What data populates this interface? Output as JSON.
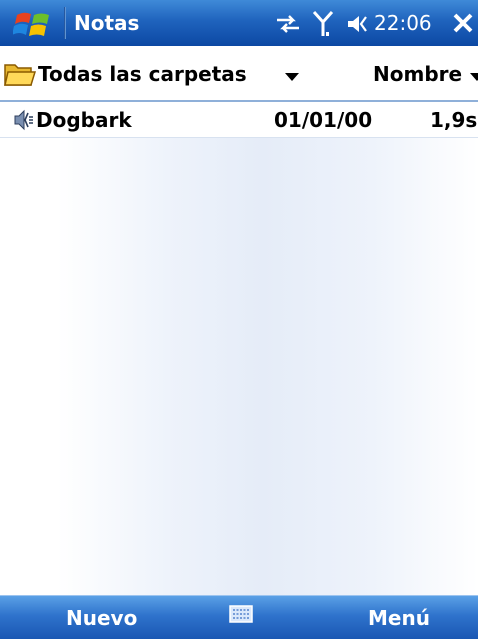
{
  "title_bar": {
    "app_title": "Notas",
    "clock": "22:06",
    "start_icon": "windows-flag-icon",
    "sync_icon": "connectivity-icon",
    "signal_icon": "signal-antenna-icon",
    "volume_icon": "speaker-icon",
    "close_icon": "close-icon"
  },
  "folder_bar": {
    "folder_label": "Todas las carpetas",
    "sort_label": "Nombre",
    "folder_icon": "folder-icon",
    "arrow_icon": "dropdown-arrow-icon"
  },
  "file_list": {
    "items": [
      {
        "icon": "sound-recording-icon",
        "name": "Dogbark",
        "date": "01/01/00",
        "length": "1,9s"
      }
    ]
  },
  "softkeys": {
    "left_label": "Nuevo",
    "right_label": "Menú",
    "keyboard_icon": "keyboard-icon"
  },
  "colors": {
    "title_bar": "#1f63bd",
    "softkey_bar": "#2f73cc",
    "text": "#000000",
    "title_text": "#ffffff"
  }
}
